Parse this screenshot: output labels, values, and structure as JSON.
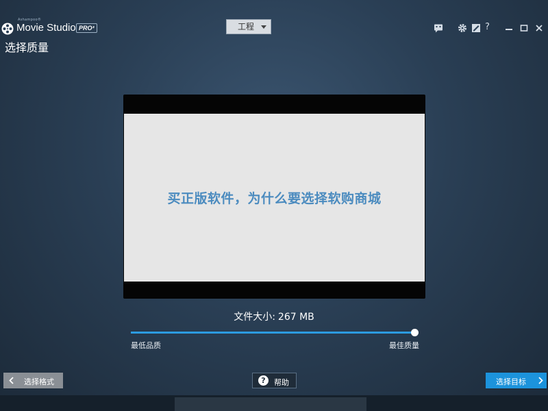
{
  "app": {
    "brand_small": "Ashampoo®",
    "name": "Movie Studio",
    "badge": "PRO³"
  },
  "toolbar": {
    "project_menu": "工程",
    "icons": [
      "chat-icon",
      "gear-icon",
      "edit-icon",
      "help-icon",
      "minimize-icon",
      "maximize-icon",
      "close-icon"
    ],
    "help_glyph": "?"
  },
  "page": {
    "heading": "选择质量"
  },
  "preview": {
    "text": "买正版软件，为什么要选择软购商城"
  },
  "file_size": {
    "label": "文件大小:",
    "value": "267 MB"
  },
  "quality_slider": {
    "min_label": "最低品质",
    "max_label": "最佳质量",
    "level": 1.0
  },
  "footer": {
    "back_label": "选择格式",
    "help_label": "帮助",
    "help_glyph": "?",
    "next_label": "选择目标"
  },
  "colors": {
    "accent": "#1c93dc",
    "preview_text": "#4b8bbf",
    "back_button": "#8a8f95"
  }
}
